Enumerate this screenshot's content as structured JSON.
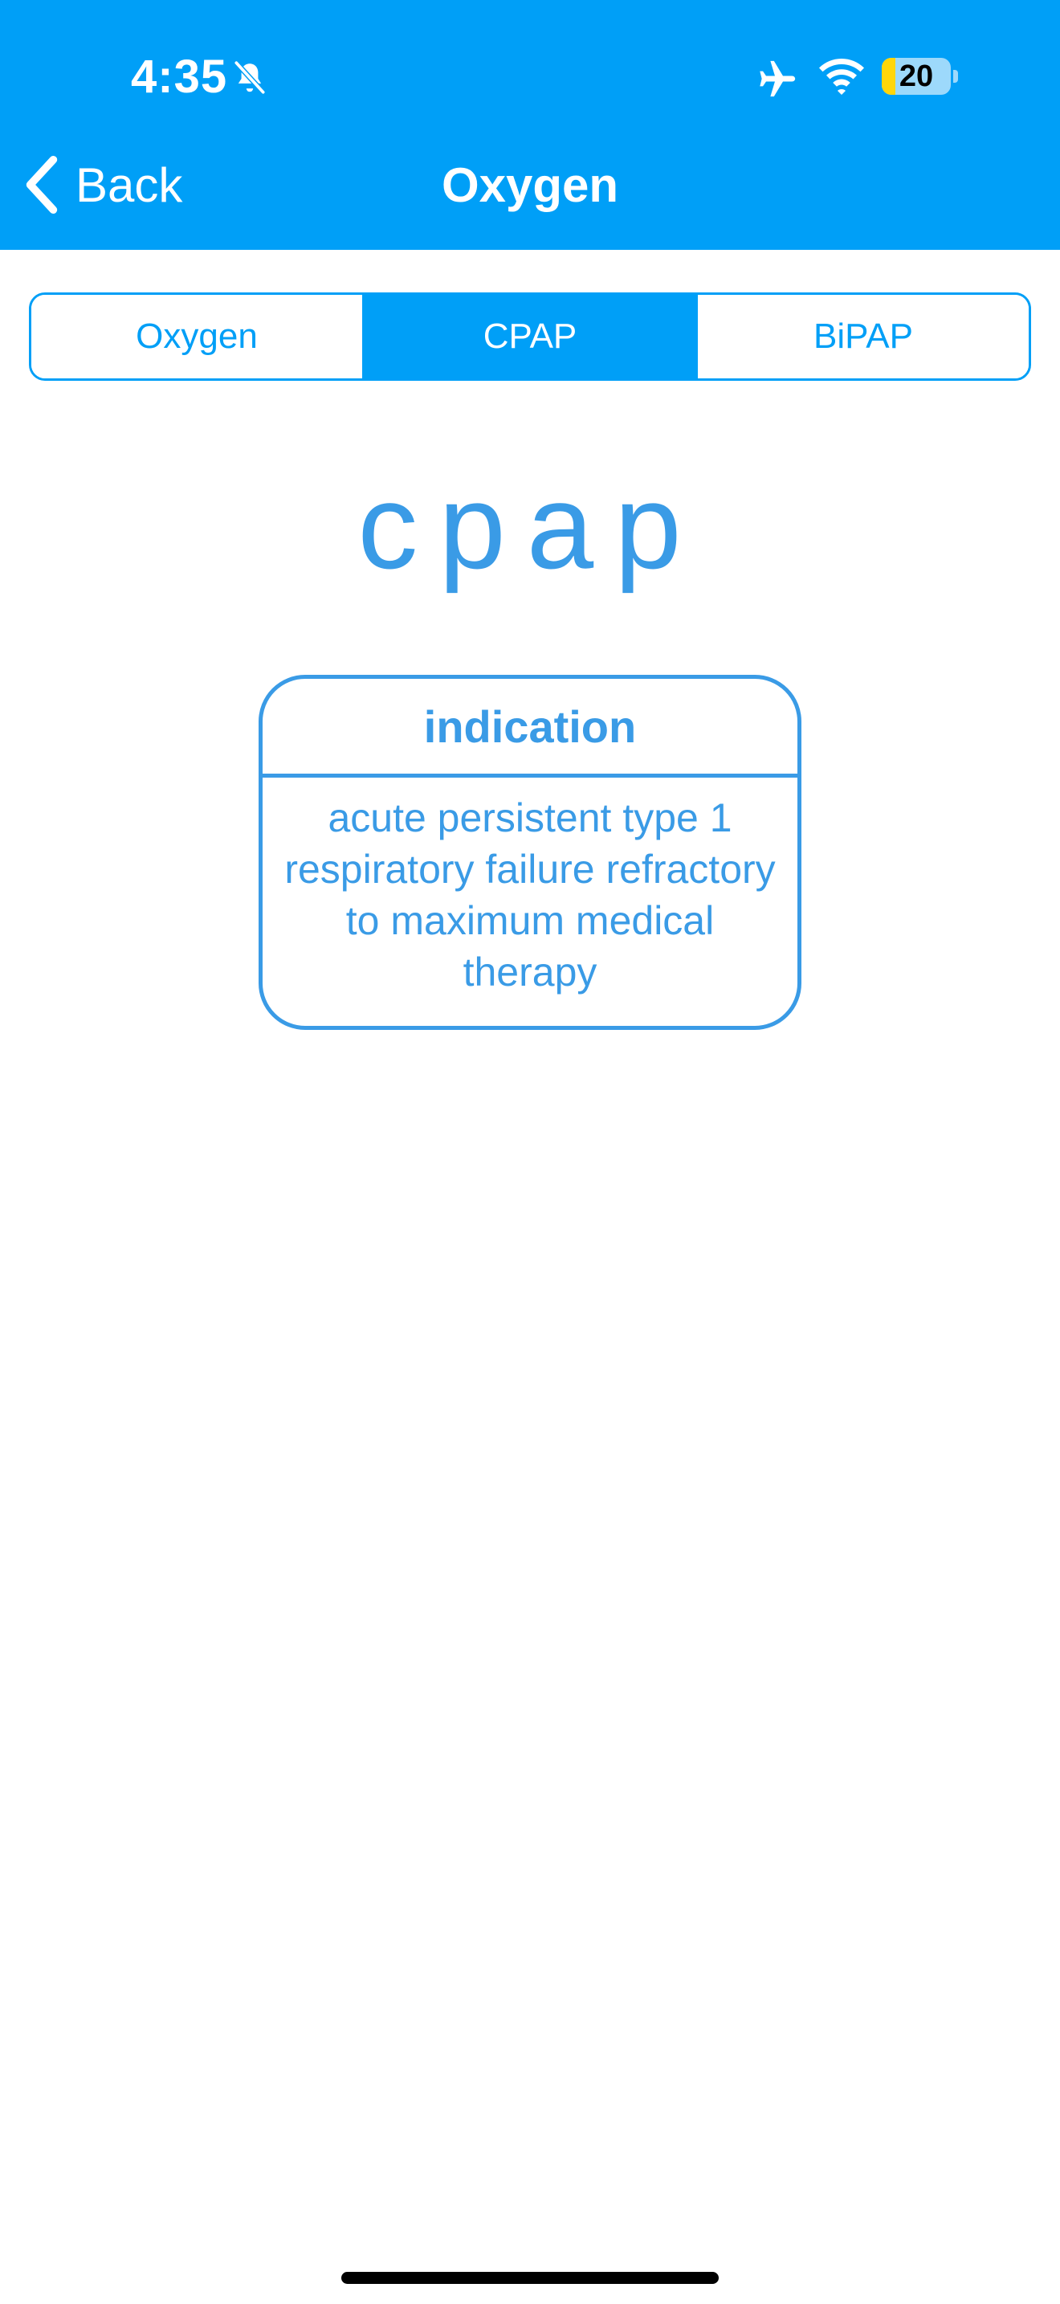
{
  "status_bar": {
    "time": "4:35",
    "battery_level": "20",
    "battery_fraction": 0.2
  },
  "nav": {
    "back_label": "Back",
    "title": "Oxygen"
  },
  "tabs": [
    {
      "label": "Oxygen",
      "selected": false
    },
    {
      "label": "CPAP",
      "selected": true
    },
    {
      "label": "BiPAP",
      "selected": false
    }
  ],
  "main": {
    "heading": "cpap",
    "card": {
      "title": "indication",
      "body": "acute persistent type 1 respiratory failure refractory to maximum medical therapy"
    }
  },
  "colors": {
    "header_background": "#009ff7",
    "accent": "#3a9be6",
    "battery_fill": "#ffd60a"
  },
  "icons": {
    "silent": "bell-slash-icon",
    "airplane": "airplane-icon",
    "wifi": "wifi-icon",
    "back": "chevron-left-icon"
  }
}
